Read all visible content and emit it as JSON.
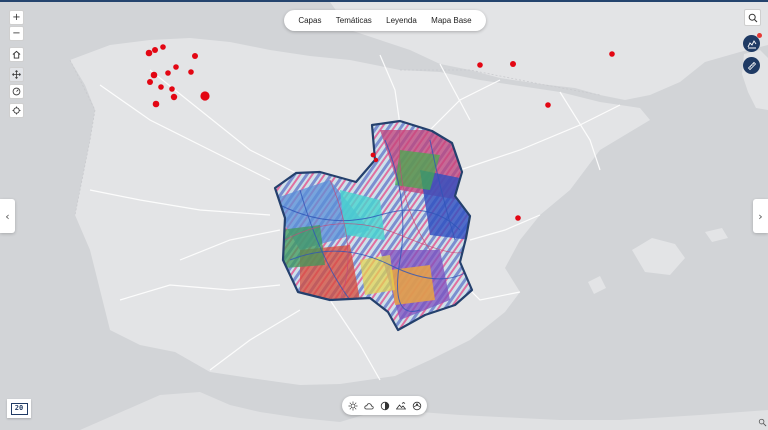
{
  "menu": {
    "items": [
      {
        "id": "capas",
        "label": "Capas"
      },
      {
        "id": "tematicas",
        "label": "Temáticas"
      },
      {
        "id": "leyenda",
        "label": "Leyenda"
      },
      {
        "id": "mapa-base",
        "label": "Mapa Base"
      }
    ]
  },
  "zoom": {
    "in_label": "+",
    "out_label": "−"
  },
  "nav": {
    "left_arrow": "‹",
    "right_arrow": "›"
  },
  "logo": {
    "text": "20"
  },
  "icons": {
    "home": "home-icon",
    "pan": "move-icon",
    "measure": "speedometer-icon",
    "locate": "locate-icon",
    "search": "search-icon",
    "chart": "chart-icon",
    "ruler": "ruler-icon",
    "bottom_tools": [
      "sun-icon",
      "cloud-icon",
      "contrast-icon",
      "landscape-icon",
      "drop-icon"
    ]
  },
  "colors": {
    "accent": "#1f3a64",
    "marker": "#e30613",
    "land": "#e3e4e6",
    "sea": "#d2d4d7",
    "region_border": "#24406d"
  },
  "map": {
    "markers_count": 21
  }
}
